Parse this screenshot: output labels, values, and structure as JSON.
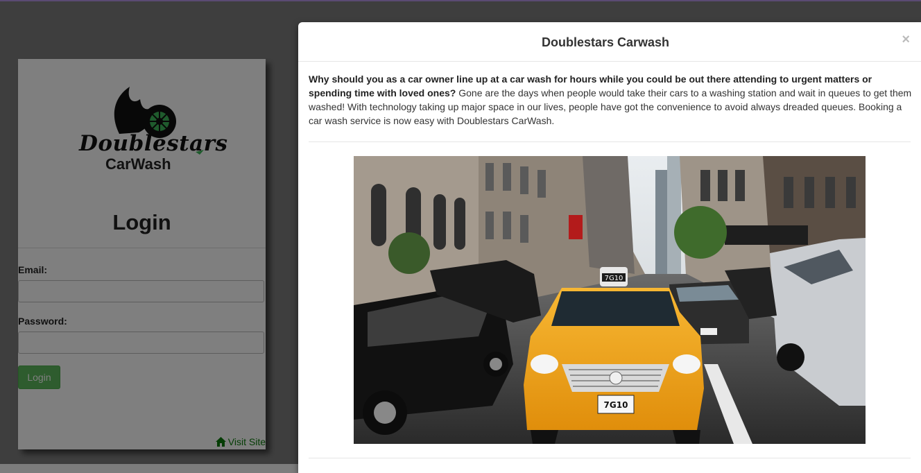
{
  "login": {
    "logo_word": "Doublestars",
    "logo_sub": "CarWash",
    "title": "Login",
    "email_label": "Email:",
    "password_label": "Password:",
    "button_label": "Login",
    "visit_site": "Visit Site"
  },
  "modal": {
    "title": "Doublestars Carwash",
    "close": "×",
    "intro_bold": "Why should you as a car owner line up at a car wash for hours while you could be out there attending to urgent matters or spending time with loved ones?",
    "intro_rest": " Gone are the days when people would take their cars to a washing station and wait in queues to get them washed! With technology taking up major space in our lives, people have got the convenience to avoid always dreaded queues. Booking a car wash service is now easy with Doublestars CarWash.",
    "photo_taxi_number": "7G10",
    "photo_plate": "7G10"
  },
  "colors": {
    "accent_green": "#5cb85c",
    "link_green": "#0a7a0a",
    "taxi_yellow": "#f0a21c"
  }
}
